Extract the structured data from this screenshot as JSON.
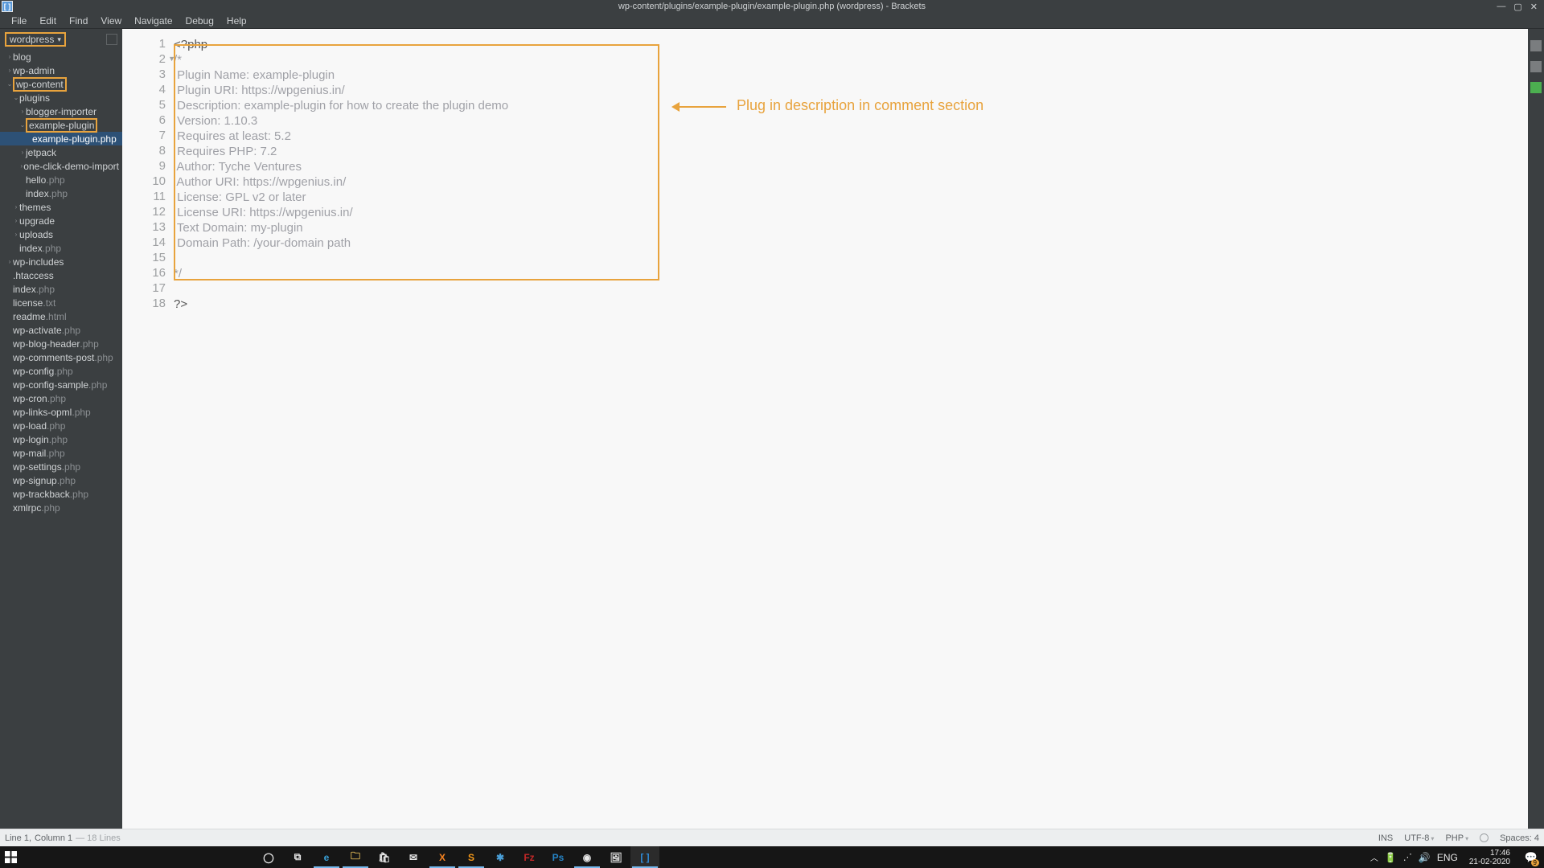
{
  "window": {
    "title": "wp-content/plugins/example-plugin/example-plugin.php (wordpress) - Brackets",
    "app_icon_text": "[ ]"
  },
  "menu": [
    "File",
    "Edit",
    "Find",
    "View",
    "Navigate",
    "Debug",
    "Help"
  ],
  "project": {
    "name": "wordpress"
  },
  "tree": [
    {
      "depth": 0,
      "carrot": "›",
      "name": "blog",
      "ext": ""
    },
    {
      "depth": 0,
      "carrot": "›",
      "name": "wp-admin",
      "ext": ""
    },
    {
      "depth": 0,
      "carrot": "⌄",
      "name": "wp-content",
      "ext": "",
      "hl": true
    },
    {
      "depth": 1,
      "carrot": "⌄",
      "name": "plugins",
      "ext": ""
    },
    {
      "depth": 2,
      "carrot": "›",
      "name": "blogger-importer",
      "ext": ""
    },
    {
      "depth": 2,
      "carrot": "⌄",
      "name": "example-plugin",
      "ext": "",
      "hl": true
    },
    {
      "depth": 3,
      "carrot": "",
      "name": "example-plugin",
      "ext": ".php",
      "sel": true
    },
    {
      "depth": 2,
      "carrot": "›",
      "name": "jetpack",
      "ext": ""
    },
    {
      "depth": 2,
      "carrot": "›",
      "name": "one-click-demo-import",
      "ext": ""
    },
    {
      "depth": 2,
      "carrot": "",
      "name": "hello",
      "ext": ".php"
    },
    {
      "depth": 2,
      "carrot": "",
      "name": "index",
      "ext": ".php"
    },
    {
      "depth": 1,
      "carrot": "›",
      "name": "themes",
      "ext": ""
    },
    {
      "depth": 1,
      "carrot": "›",
      "name": "upgrade",
      "ext": ""
    },
    {
      "depth": 1,
      "carrot": "›",
      "name": "uploads",
      "ext": ""
    },
    {
      "depth": 1,
      "carrot": "",
      "name": "index",
      "ext": ".php"
    },
    {
      "depth": 0,
      "carrot": "›",
      "name": "wp-includes",
      "ext": ""
    },
    {
      "depth": 0,
      "carrot": "",
      "name": ".htaccess",
      "ext": ""
    },
    {
      "depth": 0,
      "carrot": "",
      "name": "index",
      "ext": ".php"
    },
    {
      "depth": 0,
      "carrot": "",
      "name": "license",
      "ext": ".txt"
    },
    {
      "depth": 0,
      "carrot": "",
      "name": "readme",
      "ext": ".html"
    },
    {
      "depth": 0,
      "carrot": "",
      "name": "wp-activate",
      "ext": ".php"
    },
    {
      "depth": 0,
      "carrot": "",
      "name": "wp-blog-header",
      "ext": ".php"
    },
    {
      "depth": 0,
      "carrot": "",
      "name": "wp-comments-post",
      "ext": ".php"
    },
    {
      "depth": 0,
      "carrot": "",
      "name": "wp-config",
      "ext": ".php"
    },
    {
      "depth": 0,
      "carrot": "",
      "name": "wp-config-sample",
      "ext": ".php"
    },
    {
      "depth": 0,
      "carrot": "",
      "name": "wp-cron",
      "ext": ".php"
    },
    {
      "depth": 0,
      "carrot": "",
      "name": "wp-links-opml",
      "ext": ".php"
    },
    {
      "depth": 0,
      "carrot": "",
      "name": "wp-load",
      "ext": ".php"
    },
    {
      "depth": 0,
      "carrot": "",
      "name": "wp-login",
      "ext": ".php"
    },
    {
      "depth": 0,
      "carrot": "",
      "name": "wp-mail",
      "ext": ".php"
    },
    {
      "depth": 0,
      "carrot": "",
      "name": "wp-settings",
      "ext": ".php"
    },
    {
      "depth": 0,
      "carrot": "",
      "name": "wp-signup",
      "ext": ".php"
    },
    {
      "depth": 0,
      "carrot": "",
      "name": "wp-trackback",
      "ext": ".php"
    },
    {
      "depth": 0,
      "carrot": "",
      "name": "xmlrpc",
      "ext": ".php"
    }
  ],
  "code_lines": [
    {
      "n": 1,
      "text": "<?php",
      "cls": "tok-dark",
      "fold": false
    },
    {
      "n": 2,
      "text": "/*",
      "cls": "tok-gray",
      "fold": true
    },
    {
      "n": 3,
      "text": " Plugin Name: example-plugin",
      "cls": "tok-gray"
    },
    {
      "n": 4,
      "text": " Plugin URI: https://wpgenius.in/",
      "cls": "tok-gray"
    },
    {
      "n": 5,
      "text": " Description: example-plugin for how to create the plugin demo",
      "cls": "tok-gray"
    },
    {
      "n": 6,
      "text": " Version: 1.10.3",
      "cls": "tok-gray"
    },
    {
      "n": 7,
      "text": " Requires at least: 5.2",
      "cls": "tok-gray"
    },
    {
      "n": 8,
      "text": " Requires PHP: 7.2",
      "cls": "tok-gray"
    },
    {
      "n": 9,
      "text": " Author: Tyche Ventures",
      "cls": "tok-gray"
    },
    {
      "n": 10,
      "text": " Author URI: https://wpgenius.in/",
      "cls": "tok-gray"
    },
    {
      "n": 11,
      "text": " License: GPL v2 or later",
      "cls": "tok-gray"
    },
    {
      "n": 12,
      "text": " License URI: https://wpgenius.in/",
      "cls": "tok-gray"
    },
    {
      "n": 13,
      "text": " Text Domain: my-plugin",
      "cls": "tok-gray"
    },
    {
      "n": 14,
      "text": " Domain Path: /your-domain path",
      "cls": "tok-gray"
    },
    {
      "n": 15,
      "text": " ",
      "cls": "tok-gray"
    },
    {
      "n": 16,
      "text": "*/",
      "cls": "tok-gray"
    },
    {
      "n": 17,
      "text": "",
      "cls": "tok-dark"
    },
    {
      "n": 18,
      "text": "?>",
      "cls": "tok-dark"
    }
  ],
  "annotation": {
    "text": "Plug in description in comment section"
  },
  "status": {
    "cursor_a": "Line 1, ",
    "cursor_b": "Column 1",
    "cursor_c": " — 18 Lines",
    "ins": "INS",
    "encoding": "UTF-8",
    "lang": "PHP",
    "spaces": "Spaces: 4"
  },
  "taskbar": {
    "icons": [
      {
        "name": "cortana-circle-icon",
        "glyph": "◯",
        "color": "#e8e8e8"
      },
      {
        "name": "taskview-icon",
        "glyph": "⧉",
        "color": "#e8e8e8"
      },
      {
        "name": "edge-icon",
        "glyph": "e",
        "color": "#39a0d6",
        "running": true
      },
      {
        "name": "file-explorer-icon",
        "glyph": "🗀",
        "color": "#f2c75c",
        "running": true
      },
      {
        "name": "store-icon",
        "glyph": "🛍",
        "color": "#e8e8e8"
      },
      {
        "name": "mail-icon",
        "glyph": "✉",
        "color": "#e8e8e8"
      },
      {
        "name": "xampp-icon",
        "glyph": "X",
        "color": "#f58220",
        "running": true
      },
      {
        "name": "sublime-icon",
        "glyph": "S",
        "color": "#f2971a",
        "running": true
      },
      {
        "name": "slack-icon",
        "glyph": "✱",
        "color": "#4a9fd8"
      },
      {
        "name": "filezilla-icon",
        "glyph": "Fz",
        "color": "#c62828"
      },
      {
        "name": "photoshop-icon",
        "glyph": "Ps",
        "color": "#2684c6"
      },
      {
        "name": "chrome-icon",
        "glyph": "◉",
        "color": "#e8e8e8",
        "running": true
      },
      {
        "name": "photos-icon",
        "glyph": "🖼",
        "color": "#e8e8e8"
      },
      {
        "name": "brackets-icon",
        "glyph": "[ ]",
        "color": "#2f8bd8",
        "active": true
      }
    ],
    "tray": {
      "lang": "ENG",
      "time": "17:46",
      "date": "21-02-2020",
      "notif_count": "9"
    }
  }
}
